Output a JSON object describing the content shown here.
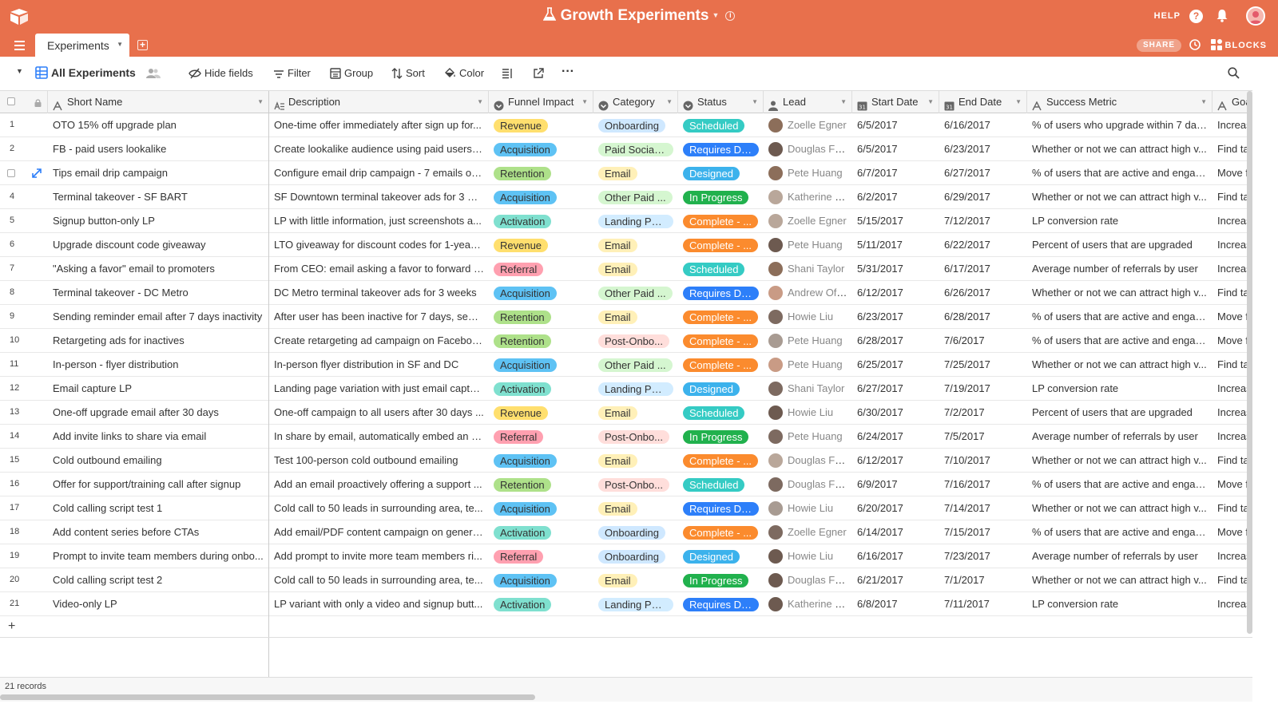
{
  "app": {
    "title": "Growth Experiments",
    "help_label": "HELP",
    "share_label": "SHARE",
    "blocks_label": "BLOCKS",
    "tab_label": "Experiments",
    "accent": "#e8704c"
  },
  "viewbar": {
    "view_name": "All Experiments",
    "hide_fields": "Hide fields",
    "filter": "Filter",
    "group": "Group",
    "sort": "Sort",
    "color": "Color"
  },
  "columns": [
    "Short Name",
    "Description",
    "Funnel Impact",
    "Category",
    "Status",
    "Lead",
    "Start Date",
    "End Date",
    "Success Metric",
    "Goal"
  ],
  "rows": [
    {
      "num": "1",
      "name": "OTO 15% off upgrade plan",
      "desc": "One-time offer immediately after sign up for...",
      "funnel": "Revenue",
      "cat": "Onboarding",
      "status": "Scheduled",
      "lead": "Zoelle Egner",
      "start": "6/5/2017",
      "end": "6/16/2017",
      "metric": "% of users who upgrade within 7 day...",
      "goal": "Increase"
    },
    {
      "num": "2",
      "name": "FB - paid users lookalike",
      "desc": "Create lookalike audience using paid users list",
      "funnel": "Acquisition",
      "cat": "Paid Social ...",
      "status": "Requires De...",
      "lead": "Douglas Forste",
      "start": "6/5/2017",
      "end": "6/23/2017",
      "metric": "Whether or not we can attract high v...",
      "goal": "Find tac"
    },
    {
      "num": "3",
      "name": "Tips email drip campaign",
      "desc": "Configure email drip campaign - 7 emails ov...",
      "funnel": "Retention",
      "cat": "Email",
      "status": "Designed",
      "lead": "Pete Huang",
      "start": "6/7/2017",
      "end": "6/27/2017",
      "metric": "% of users that are active and engaged",
      "goal": "Move fr"
    },
    {
      "num": "4",
      "name": "Terminal takeover - SF BART",
      "desc": "SF Downtown terminal takeover ads for 3 we...",
      "funnel": "Acquisition",
      "cat": "Other Paid ...",
      "status": "In Progress",
      "lead": "Katherine Duh",
      "start": "6/2/2017",
      "end": "6/29/2017",
      "metric": "Whether or not we can attract high v...",
      "goal": "Find tac"
    },
    {
      "num": "5",
      "name": "Signup button-only LP",
      "desc": "LP with little information, just screenshots a...",
      "funnel": "Activation",
      "cat": "Landing Page",
      "status": "Complete - ...",
      "lead": "Zoelle Egner",
      "start": "5/15/2017",
      "end": "7/12/2017",
      "metric": "LP conversion rate",
      "goal": "Increase"
    },
    {
      "num": "6",
      "name": "Upgrade discount code giveaway",
      "desc": "LTO giveaway for discount codes for 1-year ...",
      "funnel": "Revenue",
      "cat": "Email",
      "status": "Complete - ...",
      "lead": "Pete Huang",
      "start": "5/11/2017",
      "end": "6/22/2017",
      "metric": "Percent of users that are upgraded",
      "goal": "Increase"
    },
    {
      "num": "7",
      "name": "\"Asking a favor\" email to promoters",
      "desc": "From CEO: email asking a favor to forward e...",
      "funnel": "Referral",
      "cat": "Email",
      "status": "Scheduled",
      "lead": "Shani Taylor",
      "start": "5/31/2017",
      "end": "6/17/2017",
      "metric": "Average number of referrals by user",
      "goal": "Increase"
    },
    {
      "num": "8",
      "name": "Terminal takeover - DC Metro",
      "desc": "DC Metro terminal takeover ads for 3 weeks",
      "funnel": "Acquisition",
      "cat": "Other Paid ...",
      "status": "Requires De...",
      "lead": "Andrew Ofstad",
      "start": "6/12/2017",
      "end": "6/26/2017",
      "metric": "Whether or not we can attract high v...",
      "goal": "Find tac"
    },
    {
      "num": "9",
      "name": "Sending reminder email after 7 days inactivity",
      "desc": "After user has been inactive for 7 days, send...",
      "funnel": "Retention",
      "cat": "Email",
      "status": "Complete - ...",
      "lead": "Howie Liu",
      "start": "6/23/2017",
      "end": "6/28/2017",
      "metric": "% of users that are active and engaged",
      "goal": "Move fr"
    },
    {
      "num": "10",
      "name": "Retargeting ads for inactives",
      "desc": "Create retargeting ad campaign on Faceboo...",
      "funnel": "Retention",
      "cat": "Post-Onbo...",
      "status": "Complete - ...",
      "lead": "Pete Huang",
      "start": "6/28/2017",
      "end": "7/6/2017",
      "metric": "% of users that are active and engaged",
      "goal": "Move fr"
    },
    {
      "num": "11",
      "name": "In-person - flyer distribution",
      "desc": "In-person flyer distribution in SF and DC",
      "funnel": "Acquisition",
      "cat": "Other Paid ...",
      "status": "Complete - ...",
      "lead": "Pete Huang",
      "start": "6/25/2017",
      "end": "7/25/2017",
      "metric": "Whether or not we can attract high v...",
      "goal": "Find tac"
    },
    {
      "num": "12",
      "name": "Email capture LP",
      "desc": "Landing page variation with just email capture",
      "funnel": "Activation",
      "cat": "Landing Page",
      "status": "Designed",
      "lead": "Shani Taylor",
      "start": "6/27/2017",
      "end": "7/19/2017",
      "metric": "LP conversion rate",
      "goal": "Increase"
    },
    {
      "num": "13",
      "name": "One-off upgrade email after 30 days",
      "desc": "One-off campaign to all users after 30 days ...",
      "funnel": "Revenue",
      "cat": "Email",
      "status": "Scheduled",
      "lead": "Howie Liu",
      "start": "6/30/2017",
      "end": "7/2/2017",
      "metric": "Percent of users that are upgraded",
      "goal": "Increase"
    },
    {
      "num": "14",
      "name": "Add invite links to share via email",
      "desc": "In share by email, automatically embed an in...",
      "funnel": "Referral",
      "cat": "Post-Onbo...",
      "status": "In Progress",
      "lead": "Pete Huang",
      "start": "6/24/2017",
      "end": "7/5/2017",
      "metric": "Average number of referrals by user",
      "goal": "Increase"
    },
    {
      "num": "15",
      "name": "Cold outbound emailing",
      "desc": "Test 100-person cold outbound emailing",
      "funnel": "Acquisition",
      "cat": "Email",
      "status": "Complete - ...",
      "lead": "Douglas Forste",
      "start": "6/12/2017",
      "end": "7/10/2017",
      "metric": "Whether or not we can attract high v...",
      "goal": "Find tac"
    },
    {
      "num": "16",
      "name": "Offer for support/training call after signup",
      "desc": "Add an email proactively offering a support ...",
      "funnel": "Retention",
      "cat": "Post-Onbo...",
      "status": "Scheduled",
      "lead": "Douglas Forste",
      "start": "6/9/2017",
      "end": "7/16/2017",
      "metric": "% of users that are active and engaged",
      "goal": "Move fr"
    },
    {
      "num": "17",
      "name": "Cold calling script test 1",
      "desc": "Cold call to 50 leads in surrounding area, te...",
      "funnel": "Acquisition",
      "cat": "Email",
      "status": "Requires De...",
      "lead": "Howie Liu",
      "start": "6/20/2017",
      "end": "7/14/2017",
      "metric": "Whether or not we can attract high v...",
      "goal": "Find tac"
    },
    {
      "num": "18",
      "name": "Add content series before CTAs",
      "desc": "Add email/PDF content campaign on general...",
      "funnel": "Activation",
      "cat": "Onboarding",
      "status": "Complete - ...",
      "lead": "Zoelle Egner",
      "start": "6/14/2017",
      "end": "7/15/2017",
      "metric": "% of users that are active and engaged",
      "goal": "Move fr"
    },
    {
      "num": "19",
      "name": "Prompt to invite team members during onbo...",
      "desc": "Add prompt to invite more team members ri...",
      "funnel": "Referral",
      "cat": "Onboarding",
      "status": "Designed",
      "lead": "Howie Liu",
      "start": "6/16/2017",
      "end": "7/23/2017",
      "metric": "Average number of referrals by user",
      "goal": "Increase"
    },
    {
      "num": "20",
      "name": "Cold calling script test 2",
      "desc": "Cold call to 50 leads in surrounding area, te...",
      "funnel": "Acquisition",
      "cat": "Email",
      "status": "In Progress",
      "lead": "Douglas Forste",
      "start": "6/21/2017",
      "end": "7/1/2017",
      "metric": "Whether or not we can attract high v...",
      "goal": "Find tac"
    },
    {
      "num": "21",
      "name": "Video-only LP",
      "desc": "LP variant with only a video and signup butt...",
      "funnel": "Activation",
      "cat": "Landing Page",
      "status": "Requires De...",
      "lead": "Katherine Duh",
      "start": "6/8/2017",
      "end": "7/11/2017",
      "metric": "LP conversion rate",
      "goal": "Increase"
    }
  ],
  "footer": {
    "records": "21 records",
    "add_row": "+"
  },
  "colors": {
    "funnel": {
      "Revenue": "#ffdf6e",
      "Acquisition": "#5ec2f4",
      "Retention": "#aee18a",
      "Activation": "#7fe0cf",
      "Referral": "#ffa0b0"
    },
    "category": {
      "Onboarding": "#cfe8ff",
      "Paid Social ...": "#d5f6d0",
      "Email": "#fff0b8",
      "Other Paid ...": "#d5f6d0",
      "Landing Page": "#d2ecff",
      "Post-Onbo...": "#ffdedb"
    },
    "status": {
      "Scheduled": "#35cbc4",
      "Requires De...": "#2d7ff9",
      "Designed": "#3cb2ec",
      "In Progress": "#21b14d",
      "Complete - ...": "#fb8b2e"
    },
    "status_text": "#ffffff"
  }
}
